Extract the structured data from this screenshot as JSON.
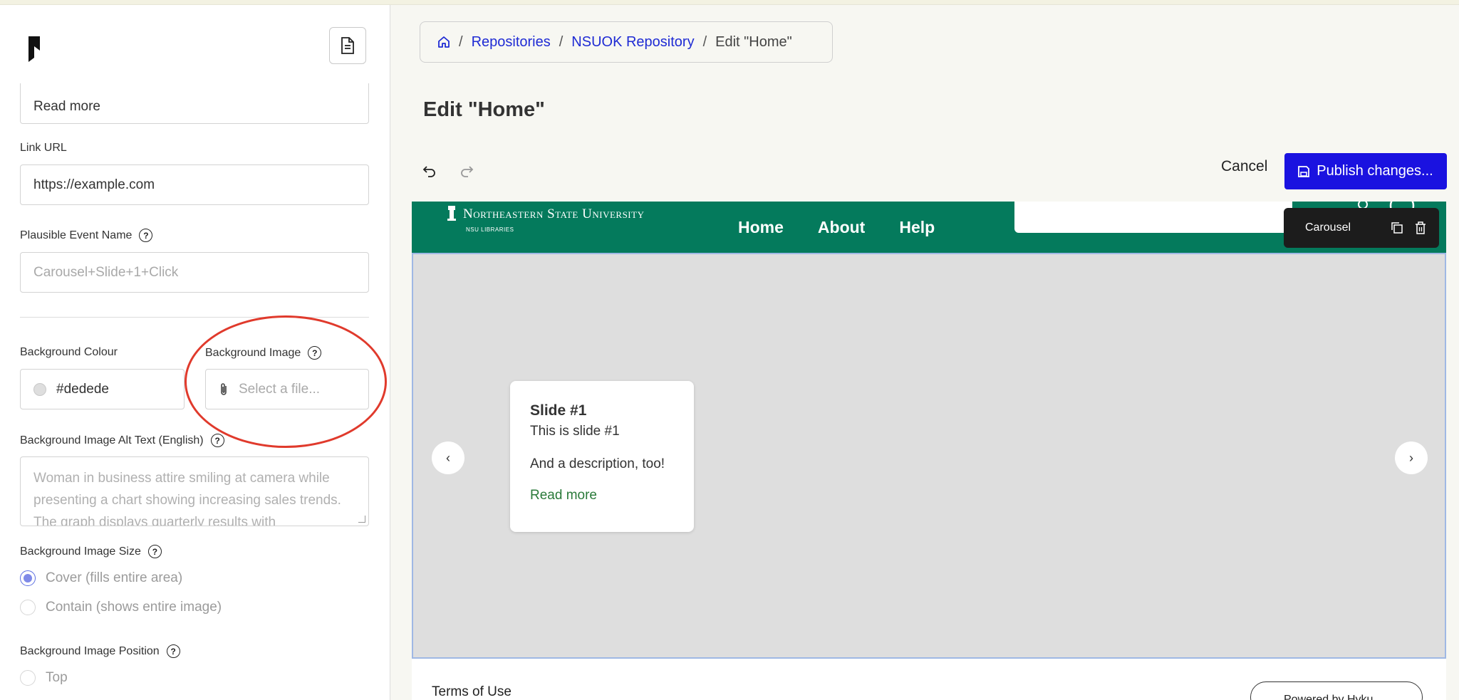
{
  "sidebar": {
    "link_text_value": "Read more",
    "link_url_label": "Link URL",
    "link_url_value": "https://example.com",
    "plausible_label": "Plausible Event Name",
    "plausible_placeholder": "Carousel+Slide+1+Click",
    "bg_colour_label": "Background Colour",
    "bg_colour_value": "#dedede",
    "bg_image_label": "Background Image",
    "bg_image_placeholder": "Select a file...",
    "alt_text_label": "Background Image Alt Text (English)",
    "alt_text_placeholder": "Woman in business attire smiling at camera while presenting a chart showing increasing sales trends. The graph displays quarterly results with",
    "size_label": "Background Image Size",
    "size_options": [
      "Cover (fills entire area)",
      "Contain (shows entire image)"
    ],
    "size_selected": "Cover (fills entire area)",
    "position_label": "Background Image Position",
    "position_option_top": "Top"
  },
  "breadcrumb": {
    "items": [
      "Repositories",
      "NSUOK Repository"
    ],
    "current": "Edit \"Home\"",
    "separator": "/"
  },
  "page": {
    "title": "Edit \"Home\"",
    "cancel_label": "Cancel",
    "publish_label": "Publish changes..."
  },
  "preview": {
    "site_name": "Northeastern State University",
    "site_subname": "NSU LIBRARIES",
    "nav": [
      "Home",
      "About",
      "Help"
    ],
    "carousel_toolbar_label": "Carousel",
    "slide": {
      "title": "Slide #1",
      "subtitle": "This is slide #1",
      "description": "And a description, too!",
      "link": "Read more"
    },
    "footer_terms": "Terms of Use",
    "footer_pill": "Powered by Hyku"
  },
  "colors": {
    "publish": "#1a12e0",
    "site_header": "#047a5c",
    "annotation": "#e03a2c",
    "carousel_bg": "#dedede"
  }
}
